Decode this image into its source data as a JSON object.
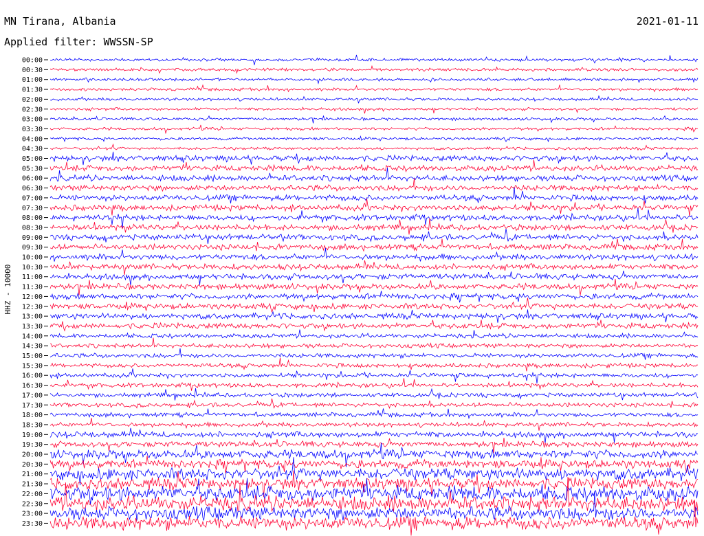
{
  "header": {
    "station": "MN Tirana, Albania",
    "date": "2021-01-11",
    "filter": "Applied filter: WWSSN-SP"
  },
  "chart_data": {
    "type": "line",
    "title": "MN Tirana, Albania",
    "ylabel": "HHZ - 10000",
    "series_colors": [
      "#0000ff",
      "#ff0033"
    ],
    "row_labels": [
      "00:00",
      "00:30",
      "01:00",
      "01:30",
      "02:00",
      "02:30",
      "03:00",
      "03:30",
      "04:00",
      "04:30",
      "05:00",
      "05:30",
      "06:00",
      "06:30",
      "07:00",
      "07:30",
      "08:00",
      "08:30",
      "09:00",
      "09:30",
      "10:00",
      "10:30",
      "11:00",
      "11:30",
      "12:00",
      "12:30",
      "13:00",
      "13:30",
      "14:00",
      "14:30",
      "15:00",
      "15:30",
      "16:00",
      "16:30",
      "17:00",
      "17:30",
      "18:00",
      "18:30",
      "19:00",
      "19:30",
      "20:00",
      "20:30",
      "21:00",
      "21:30",
      "22:00",
      "22:30",
      "23:00",
      "23:30"
    ],
    "row_amplitude": [
      2,
      2,
      2,
      2,
      2,
      2,
      2,
      2,
      2,
      2,
      4,
      4,
      4,
      4,
      4,
      4,
      4,
      4,
      4,
      4,
      4,
      4,
      4,
      4,
      4,
      4,
      4,
      4,
      3,
      3,
      3,
      3,
      3,
      3,
      3,
      3,
      3,
      3,
      4,
      4,
      6,
      6,
      8,
      8,
      10,
      10,
      9,
      9
    ],
    "grid": false,
    "legend": "none"
  }
}
